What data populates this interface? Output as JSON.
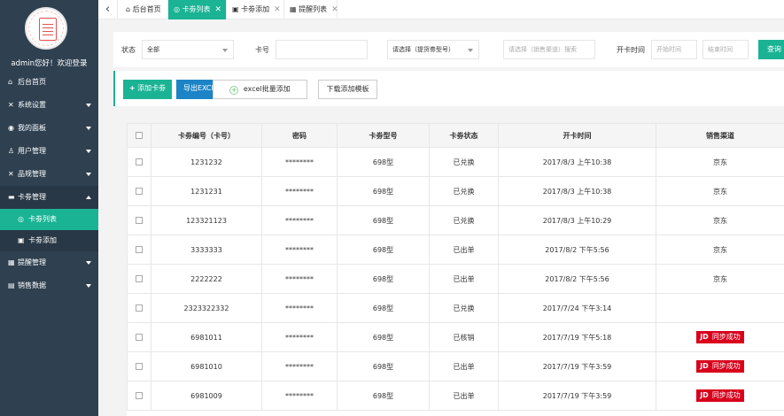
{
  "profile": {
    "greeting": "admin您好！欢迎登录"
  },
  "sidebar": {
    "items": [
      {
        "label": "后台首页",
        "icon": "home-icon",
        "caret": false
      },
      {
        "label": "系统设置",
        "icon": "wrench-icon",
        "caret": true
      },
      {
        "label": "我的面板",
        "icon": "user-circle-icon",
        "caret": true
      },
      {
        "label": "用户管理",
        "icon": "users-icon",
        "caret": true
      },
      {
        "label": "品规管理",
        "icon": "tools-icon",
        "caret": true
      },
      {
        "label": "卡劵管理",
        "icon": "ticket-icon",
        "caret": true
      }
    ],
    "sub_items": [
      {
        "label": "卡劵列表",
        "icon": "target-icon",
        "active": true
      },
      {
        "label": "卡劵添加",
        "icon": "card-icon",
        "active": false
      }
    ],
    "items_after": [
      {
        "label": "提醒管理",
        "icon": "bell-icon",
        "caret": true
      },
      {
        "label": "销售数据",
        "icon": "chart-icon",
        "caret": true
      }
    ]
  },
  "tabs": [
    {
      "label": "后台首页",
      "icon": "home-icon",
      "active": false,
      "closable": false
    },
    {
      "label": "卡劵列表",
      "icon": "target-icon",
      "active": true,
      "closable": true
    },
    {
      "label": "卡劵添加",
      "icon": "card-icon",
      "active": false,
      "closable": true
    },
    {
      "label": "提醒列表",
      "icon": "bell-icon",
      "active": false,
      "closable": true
    }
  ],
  "filter": {
    "status_label": "状态",
    "status_value": "全部",
    "card_no_label": "卡号",
    "card_no_value": "",
    "type_placeholder": "请选择（提货劵型号）",
    "channel_placeholder": "请选择（销售渠道）搜索",
    "open_time_label": "开卡时间",
    "start_placeholder": "开始时间",
    "end_placeholder": "结束时间",
    "search_label": "查询"
  },
  "toolbar": {
    "add_label": "添加卡劵",
    "export_label": "导出EXCEL",
    "batch_label": "excel批量添加",
    "template_label": "下载添加模板"
  },
  "table": {
    "headers": [
      "卡劵编号（卡号）",
      "密码",
      "卡劵型号",
      "卡劵状态",
      "开卡时间",
      "销售渠道"
    ],
    "rows": [
      {
        "id": "1231232",
        "password": "********",
        "model": "698型",
        "status": "已兑换",
        "open_time": "2017/8/3 上午10:38",
        "channel": "京东",
        "badge": false
      },
      {
        "id": "1231231",
        "password": "********",
        "model": "698型",
        "status": "已兑换",
        "open_time": "2017/8/3 上午10:38",
        "channel": "京东",
        "badge": false
      },
      {
        "id": "123321123",
        "password": "********",
        "model": "698型",
        "status": "已兑换",
        "open_time": "2017/8/3 上午10:29",
        "channel": "京东",
        "badge": false
      },
      {
        "id": "3333333",
        "password": "********",
        "model": "698型",
        "status": "已出单",
        "open_time": "2017/8/2 下午5:56",
        "channel": "京东",
        "badge": false
      },
      {
        "id": "2222222",
        "password": "********",
        "model": "698型",
        "status": "已出单",
        "open_time": "2017/8/2 下午5:56",
        "channel": "京东",
        "badge": false
      },
      {
        "id": "2323322332",
        "password": "********",
        "model": "698型",
        "status": "已兑换",
        "open_time": "2017/7/24 下午3:14",
        "channel": "",
        "badge": false
      },
      {
        "id": "6981011",
        "password": "********",
        "model": "698型",
        "status": "已核销",
        "open_time": "2017/7/19 下午5:18",
        "channel": "同步成功",
        "badge": true
      },
      {
        "id": "6981010",
        "password": "********",
        "model": "698型",
        "status": "已出单",
        "open_time": "2017/7/19 下午3:59",
        "channel": "同步成功",
        "badge": true
      },
      {
        "id": "6981009",
        "password": "********",
        "model": "698型",
        "status": "已出单",
        "open_time": "2017/7/19 下午3:59",
        "channel": "同步成功",
        "badge": true
      }
    ],
    "badge_logo": "JD"
  },
  "colors": {
    "sidebar_bg": "#2f4050",
    "accent": "#1ab394",
    "jd_red": "#d9001b"
  }
}
